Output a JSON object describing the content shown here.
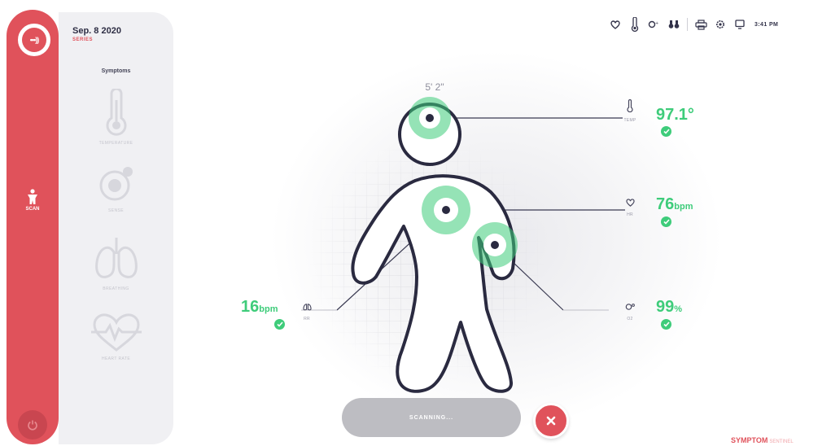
{
  "header": {
    "date": "Sep. 8 2020",
    "subtitle": "SERIES"
  },
  "logo": {
    "text": "•••))"
  },
  "sidebar": {
    "scan_label": "SCAN",
    "symptoms_title": "Symptoms",
    "symptoms": [
      {
        "label": "TEMPERATURE",
        "icon": "thermometer-icon"
      },
      {
        "label": "SENSE",
        "icon": "sense-icon"
      },
      {
        "label": "BREATHING",
        "icon": "lungs-icon"
      },
      {
        "label": "HEART RATE",
        "icon": "heart-pulse-icon"
      }
    ]
  },
  "toolbar": {
    "time": "3:41 PM",
    "icons": [
      "heart-icon",
      "thermometer-icon",
      "oxygen-icon",
      "binoculars-icon",
      "printer-icon",
      "settings-icon",
      "monitor-icon"
    ]
  },
  "body": {
    "height_label": "5' 2\""
  },
  "readouts": {
    "temperature": {
      "value": "97.1°",
      "unit": "",
      "label": "TEMP"
    },
    "heart_rate": {
      "value": "76",
      "unit": "bpm",
      "label": "HR"
    },
    "respiration": {
      "value": "16",
      "unit": "bpm",
      "label": "RR"
    },
    "oxygen": {
      "value": "99",
      "unit": "%",
      "label": "O2"
    }
  },
  "scan_button": {
    "label": "SCANNING..."
  },
  "brand": {
    "name": "SYMPTOM",
    "sub": "SENTINEL"
  },
  "colors": {
    "accent": "#e0525b",
    "ok": "#3ecc7a",
    "ink": "#2e2e44"
  }
}
